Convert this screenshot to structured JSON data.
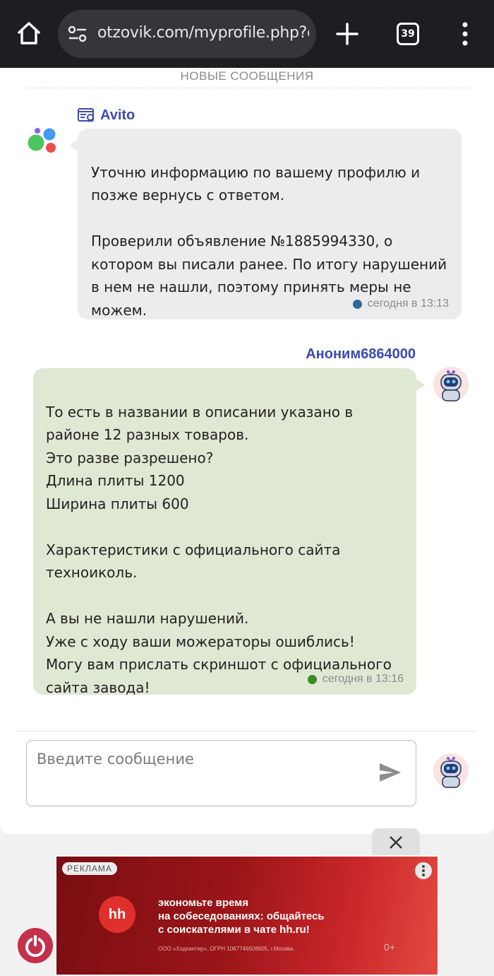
{
  "browser": {
    "url": "otzovik.com/myprofile.php?ev",
    "tab_count": "39"
  },
  "chat": {
    "new_messages_label": "НОВЫЕ СООБЩЕНИЯ",
    "messages": [
      {
        "sender": "Avito",
        "text": "Уточню информацию по вашему профилю и\nпозже вернусь с ответом.\n\nПроверили объявление №1885994330, о\nкотором вы писали ранее. По итогу нарушений\nв нем не нашли, поэтому принять меры не\nможем.",
        "time": "сегодня в 13:13"
      },
      {
        "sender": "Аноним6864000",
        "text": "То есть в названии в описании указано в\nрайоне 12 разных товаров.\nЭто разве разрешено?\nДлина плиты 1200\nШирина плиты 600\n\nХарактеристики с официального сайта\nтехноиколь.\n\nА вы не нашли нарушений.\nУже с ходу ваши можераторы ошиблись!\nМогу вам прислать скриншот с официального\nсайта завода!",
        "time": "сегодня в 13:16"
      }
    ],
    "input_placeholder": "Введите сообщение"
  },
  "ad": {
    "label": "РЕКЛАМА",
    "logo_text": "hh",
    "text": "экономьте время\nна собеседованиях: общайтесь\nс соискателями в чате hh.ru!",
    "legal": "ООО «Хэдхантер», ОГРН 1067746506605, г.Москва.",
    "age": "0+"
  },
  "colors": {
    "accent_name": "#3b4bb0",
    "incoming_bubble": "#ececee",
    "outgoing_bubble": "#dfe8d3",
    "dot_incoming": "#2d6a9a",
    "dot_outgoing": "#3a8a2a"
  }
}
